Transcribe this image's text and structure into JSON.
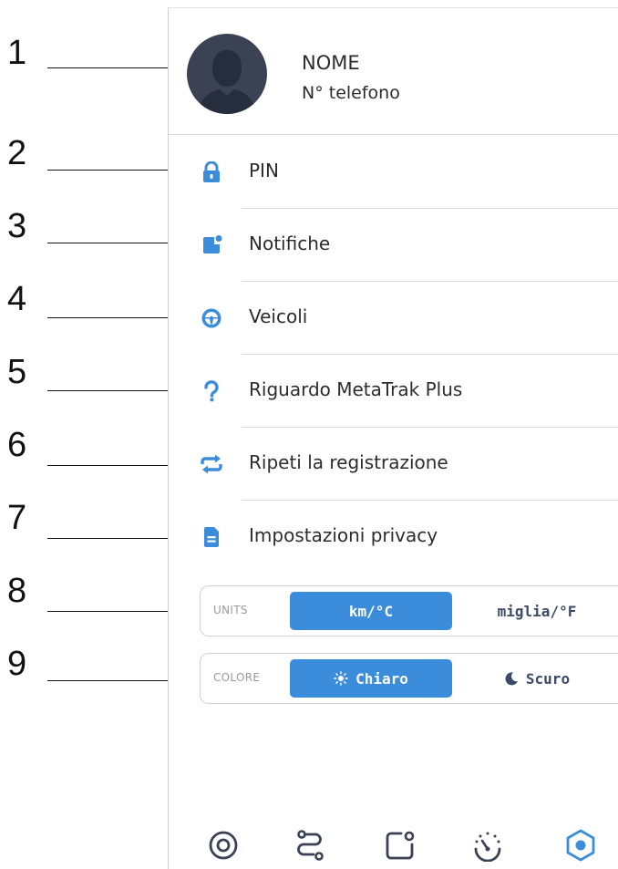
{
  "callouts": [
    "1",
    "2",
    "3",
    "4",
    "5",
    "6",
    "7",
    "8",
    "9"
  ],
  "profile": {
    "name": "NOME",
    "phone": "N° telefono"
  },
  "menu": [
    {
      "id": "pin",
      "label": "PIN",
      "icon": "lock-icon"
    },
    {
      "id": "notifiche",
      "label": "Notifiche",
      "icon": "notification-icon"
    },
    {
      "id": "veicoli",
      "label": "Veicoli",
      "icon": "steering-wheel-icon"
    },
    {
      "id": "riguardo",
      "label": "Riguardo MetaTrak Plus",
      "icon": "question-icon"
    },
    {
      "id": "ripeti",
      "label": "Ripeti la registrazione",
      "icon": "repeat-icon"
    },
    {
      "id": "privacy",
      "label": "Impostazioni privacy",
      "icon": "document-icon"
    }
  ],
  "units": {
    "label": "UNITS",
    "selected": "km/°C",
    "other": "miglia/°F"
  },
  "colore": {
    "label": "COLORE",
    "selected": "Chiaro",
    "other": "Scuro"
  },
  "bottom_nav": [
    "target-icon",
    "route-icon",
    "notification-icon",
    "speedometer-icon",
    "settings-hexagon-icon"
  ],
  "colors": {
    "accent": "#3b8ddb",
    "avatar_bg": "#3a4254",
    "text": "#2c2c2c",
    "inactive_text": "#3b4a66"
  }
}
